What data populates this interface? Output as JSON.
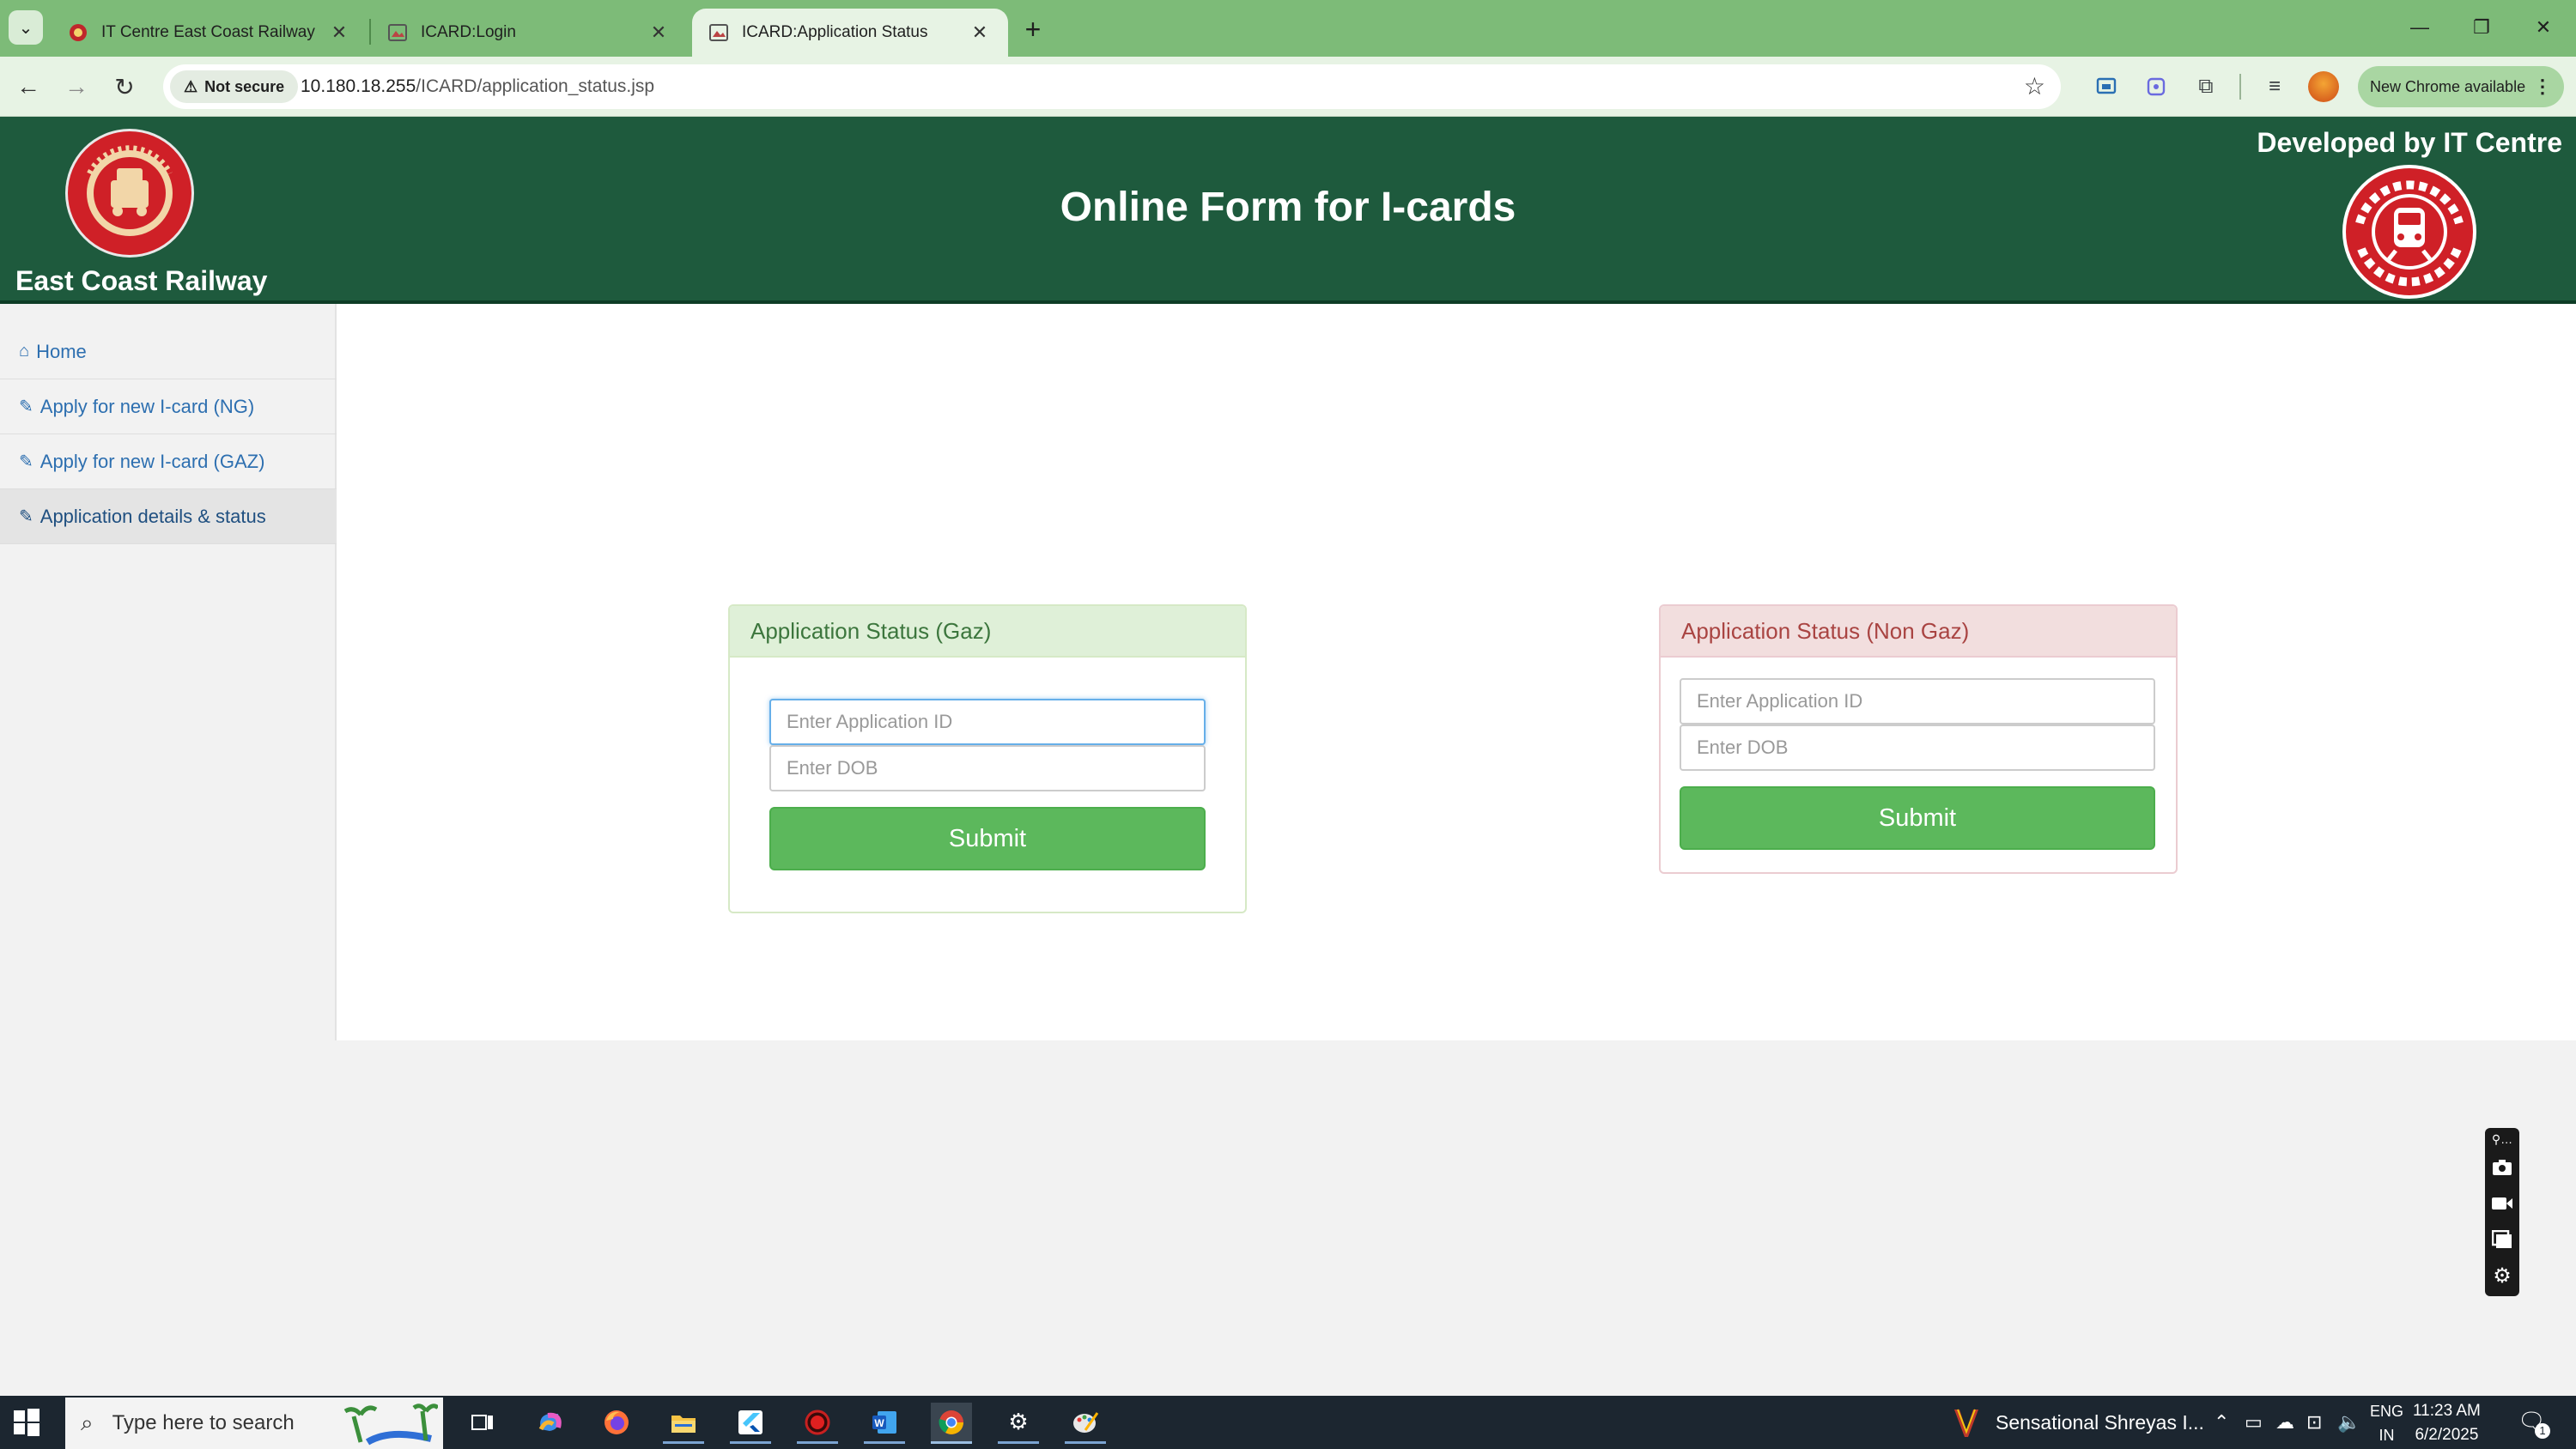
{
  "browser": {
    "tabs": [
      {
        "title": "IT Centre East Coast Railway",
        "favicon": "railway-favicon-icon"
      },
      {
        "title": "ICARD:Login",
        "favicon": "page-favicon-icon"
      },
      {
        "title": "ICARD:Application Status",
        "favicon": "page-favicon-icon",
        "active": true
      }
    ],
    "security_label": "Not secure",
    "url_host": "10.180.18.255",
    "url_path": "/ICARD/application_status.jsp",
    "update_label": "New Chrome available"
  },
  "site": {
    "brand_name": "East Coast Railway",
    "page_title": "Online Form for I-cards",
    "developer_credit": "Developed by IT Centre",
    "colors": {
      "header": "#1e5a3d",
      "link": "#2d6fb0",
      "success": "#5cb85c"
    }
  },
  "sidebar": {
    "items": [
      {
        "label": "Home",
        "icon": "home-icon"
      },
      {
        "label": "Apply for new I-card (NG)",
        "icon": "edit-icon"
      },
      {
        "label": "Apply for new I-card (GAZ)",
        "icon": "edit-icon"
      },
      {
        "label": "Application details & status",
        "icon": "edit-icon",
        "active": true
      }
    ]
  },
  "gaz_panel": {
    "heading": "Application Status (Gaz)",
    "app_id_placeholder": "Enter Application ID",
    "dob_placeholder": "Enter DOB",
    "submit_label": "Submit"
  },
  "nongaz_panel": {
    "heading": "Application Status (Non Gaz)",
    "app_id_placeholder": "Enter Application ID",
    "dob_placeholder": "Enter DOB",
    "submit_label": "Submit"
  },
  "taskbar": {
    "search_placeholder": "Type here to search",
    "media_title": "Sensational Shreyas I...",
    "language": "ENG",
    "region": "IN",
    "time": "11:23 AM",
    "date": "6/2/2025",
    "notification_count": "1"
  }
}
